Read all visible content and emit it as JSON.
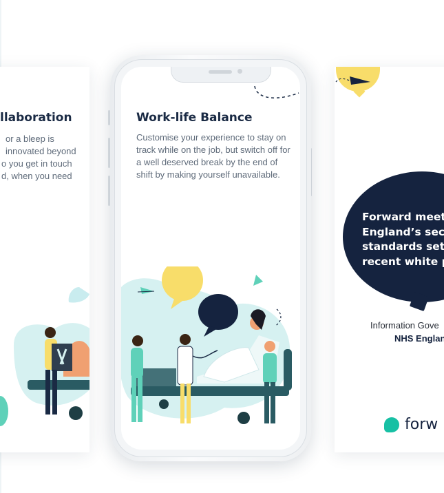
{
  "left_card": {
    "title": "llaboration",
    "lines": [
      "or a bleep is",
      "innovated beyond",
      "o you get in touch",
      "d, when you need"
    ]
  },
  "center_card": {
    "title": "Work-life Balance",
    "body": "Customise your experience to stay on track while on the job, but switch off for a well deserved break by the end of shift by making yourself unavailable."
  },
  "right_card": {
    "bubble_lines": [
      "Forward meets",
      "England’s secur",
      "standards set o",
      "recent white pa"
    ],
    "caption_line1": "Information Gove",
    "caption_line2": "NHS Englan",
    "logo_text": "forw"
  },
  "colors": {
    "navy": "#15233f",
    "teal": "#17c0a4",
    "yellow": "#f8dd6a",
    "mint": "#d6f1f1",
    "text_grey": "#5f6b7a"
  }
}
